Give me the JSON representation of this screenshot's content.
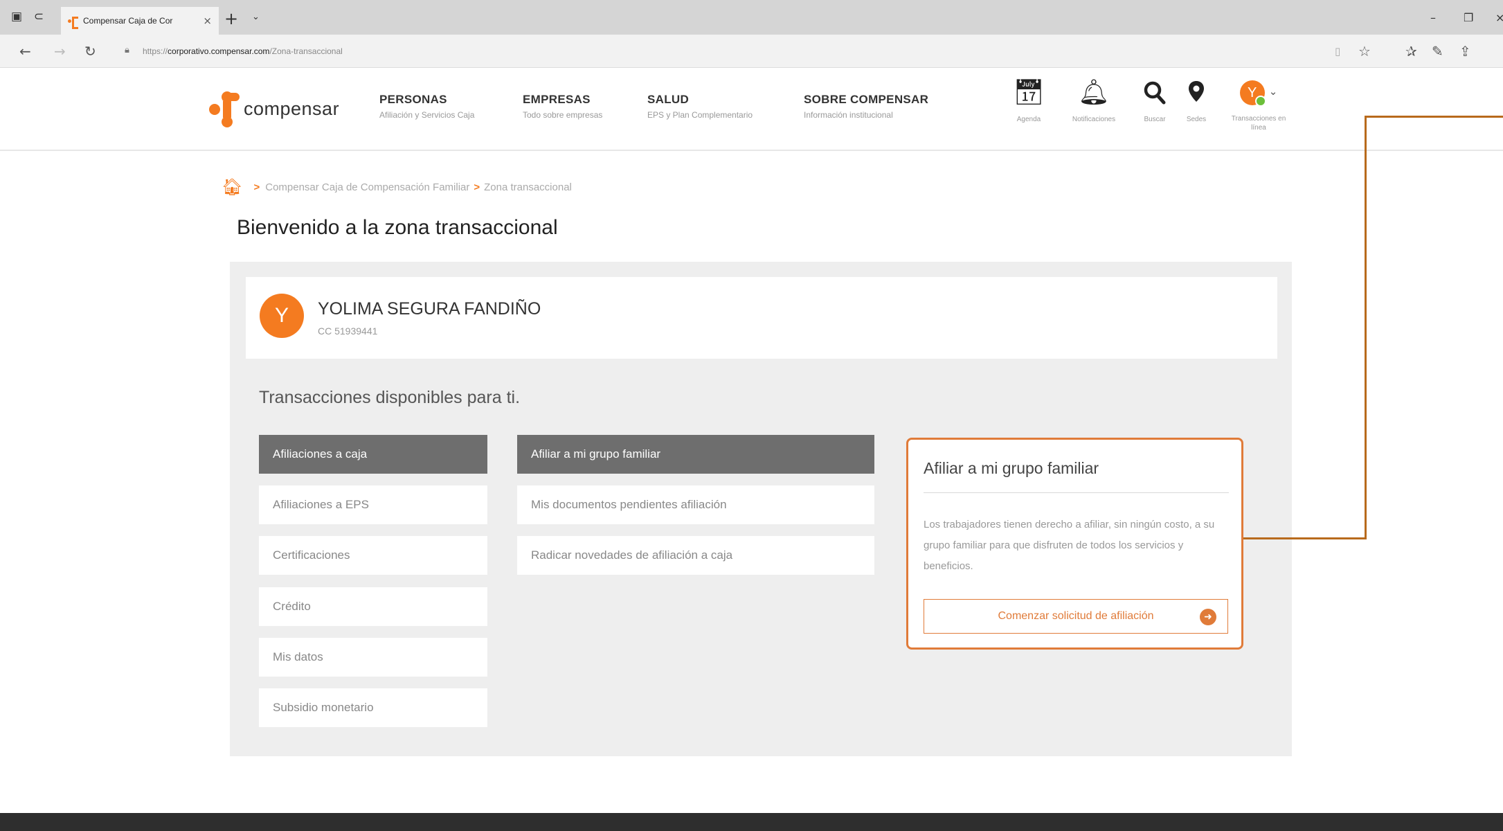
{
  "browser": {
    "tab_title": "Compensar Caja de Cor",
    "tab_close": "×",
    "new_tab": "+",
    "url_prefix": "https://",
    "url_host": "corporativo.compensar.com",
    "url_path": "/Zona-transaccional"
  },
  "header": {
    "logo_text": "compensar",
    "menu": [
      {
        "title": "PERSONAS",
        "subtitle": "Afiliación y Servicios Caja"
      },
      {
        "title": "EMPRESAS",
        "subtitle": "Todo sobre empresas"
      },
      {
        "title": "SALUD",
        "subtitle": "EPS y Plan Complementario"
      },
      {
        "title": "SOBRE COMPENSAR",
        "subtitle": "Información institucional"
      }
    ],
    "icons": [
      {
        "label": "Agenda",
        "icon": "calendar-icon"
      },
      {
        "label": "Notificaciones",
        "icon": "bell-icon"
      },
      {
        "label": "Buscar",
        "icon": "search-icon"
      },
      {
        "label": "Sedes",
        "icon": "location-pin-icon"
      }
    ],
    "user_initial": "Y",
    "user_label": "Transacciones en línea"
  },
  "breadcrumb": {
    "items": [
      "Compensar Caja de Compensación Familiar",
      "Zona transaccional"
    ]
  },
  "page_title": "Bienvenido a la zona transaccional",
  "user": {
    "initial": "Y",
    "name": "YOLIMA SEGURA FANDIÑO",
    "document": "CC 51939441"
  },
  "transactions": {
    "title": "Transacciones disponibles para ti.",
    "categories": [
      "Afiliaciones a caja",
      "Afiliaciones a EPS",
      "Certificaciones",
      "Crédito",
      "Mis datos",
      "Subsidio monetario"
    ],
    "active_category": "Afiliaciones a caja",
    "sub_options": [
      "Afiliar a mi grupo familiar",
      "Mis documentos pendientes afiliación",
      "Radicar novedades de afiliación a caja"
    ],
    "active_sub_option": "Afiliar a mi grupo familiar"
  },
  "info_card": {
    "title": "Afiliar a mi grupo familiar",
    "description": "Los trabajadores tienen derecho a afiliar, sin ningún costo, a su grupo familiar para que disfruten de todos los servicios y beneficios.",
    "button_label": "Comenzar solicitud de afiliación"
  },
  "colors": {
    "brand_orange": "#f47b20",
    "active_gray": "#6e6e6e",
    "callout_line": "#b86a1c",
    "panel_bg": "#eeeeee",
    "footer_bg": "#2e2e2e"
  }
}
